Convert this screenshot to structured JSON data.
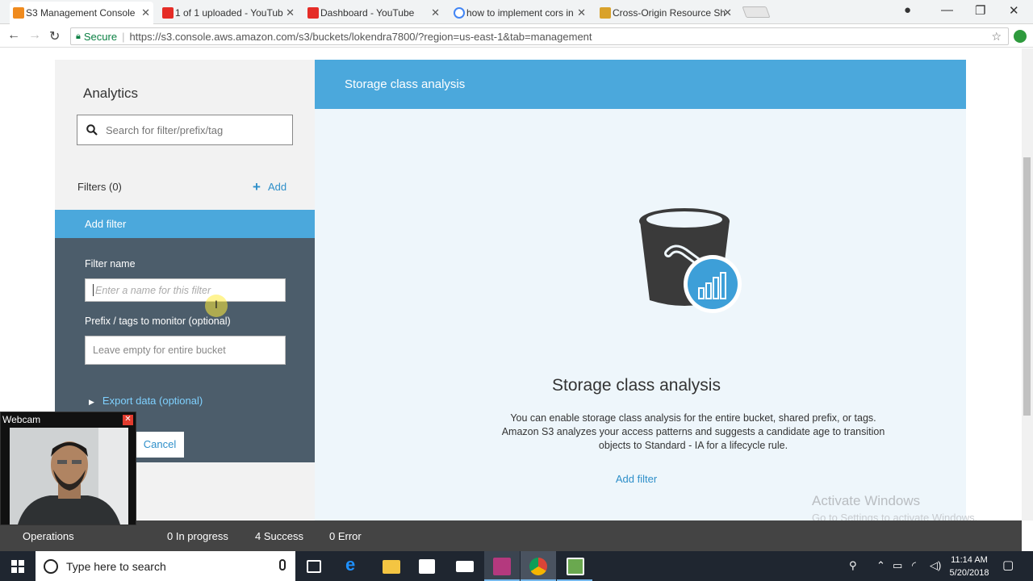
{
  "browser": {
    "tabs": [
      {
        "title": "S3 Management Console",
        "active": true,
        "favicon_color": "#f08b1e"
      },
      {
        "title": "1 of 1 uploaded - YouTub",
        "active": false,
        "favicon_color": "#e52d27"
      },
      {
        "title": "Dashboard - YouTube",
        "active": false,
        "favicon_color": "#e52d27"
      },
      {
        "title": "how to implement cors in",
        "active": false,
        "favicon_color": "#4285f4"
      },
      {
        "title": "Cross-Origin Resource Sh",
        "active": false,
        "favicon_color": "#d9a22b"
      }
    ],
    "secure_label": "Secure",
    "url": "https://s3.console.aws.amazon.com/s3/buckets/lokendra7800/?region=us-east-1&tab=management"
  },
  "sidebar": {
    "title": "Analytics",
    "search_placeholder": "Search for filter/prefix/tag",
    "filters_label": "Filters (0)",
    "add_label": "Add",
    "add_filter_header": "Add filter",
    "filter_name_label": "Filter name",
    "filter_name_placeholder": "Enter a name for this filter",
    "prefix_label": "Prefix / tags to monitor (optional)",
    "prefix_placeholder": "Leave empty for entire bucket",
    "export_label": "Export data (optional)",
    "cancel_label": "Cancel"
  },
  "main": {
    "header": "Storage class analysis",
    "title": "Storage class analysis",
    "description": "You can enable storage class analysis for the entire bucket, shared prefix, or tags. Amazon S3 analyzes your access patterns and suggests a candidate age to transition objects to Standard - IA for a lifecycle rule.",
    "add_filter_link": "Add filter"
  },
  "operations": {
    "label": "Operations",
    "in_progress": "0 In progress",
    "success": "4 Success",
    "error": "0 Error"
  },
  "webcam": {
    "title": "Webcam"
  },
  "watermark": {
    "line1": "Activate Windows",
    "line2": "Go to Settings to activate Windows."
  },
  "taskbar": {
    "search_placeholder": "Type here to search",
    "time": "11:14 AM",
    "date": "5/20/2018"
  },
  "colors": {
    "accent_blue": "#4ba8dc",
    "form_dark": "#4c5d6b",
    "link_blue": "#2e8fc9"
  }
}
